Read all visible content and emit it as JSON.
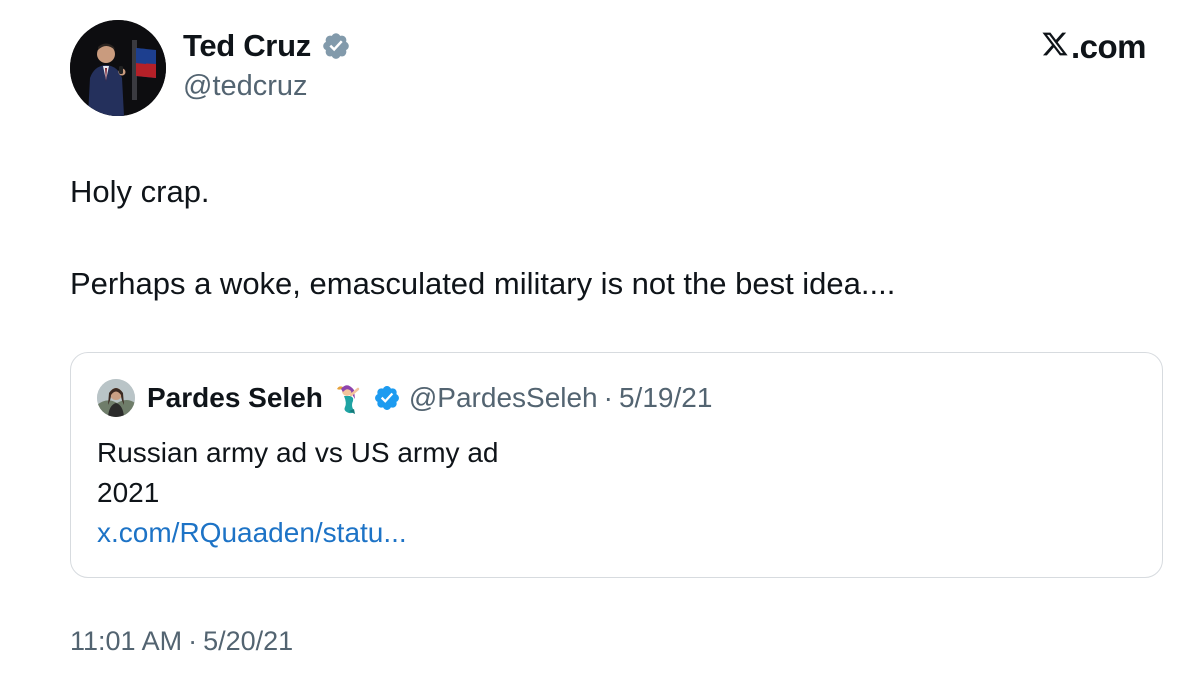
{
  "author": {
    "name": "Ted Cruz",
    "handle": "@tedcruz",
    "verified_badge_color": "#829aab"
  },
  "brand": {
    "label": ".com",
    "icon": "x-logo-icon"
  },
  "tweet": {
    "lines": [
      "Holy crap.",
      "Perhaps a woke, emasculated military is not the best idea...."
    ]
  },
  "quote": {
    "name": "Pardes Seleh",
    "emoji": "mermaid-emoji",
    "verified_badge_color": "#1d9bf0",
    "handle": "@PardesSeleh",
    "separator": "·",
    "date": "5/19/21",
    "text_lines": [
      "Russian army ad vs US army ad",
      "2021"
    ],
    "link": "x.com/RQuaaden/statu..."
  },
  "footer": {
    "time": "11:01 AM",
    "separator": "·",
    "date": "5/20/21"
  },
  "colors": {
    "text": "#0f1419",
    "muted": "#536471",
    "link": "#1d73c6",
    "border": "#d7dbdf"
  }
}
